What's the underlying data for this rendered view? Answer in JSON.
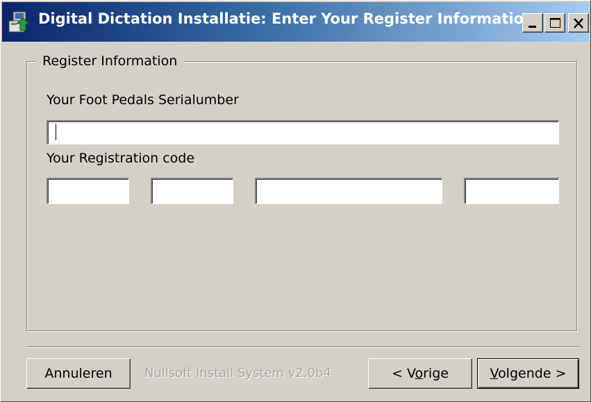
{
  "window": {
    "title": "Digital Dictation Installatie: Enter Your Register Information"
  },
  "group": {
    "legend": "Register Information",
    "serial_label": "Your Foot Pedals Serialumber",
    "serial_value": "",
    "registration_label": "Your Registration code",
    "code_fields": [
      "",
      "",
      "",
      ""
    ]
  },
  "footer": {
    "cancel_label": "Annuleren",
    "branding": "Nullsoft Install System v2.0b4",
    "back_prefix": "< V",
    "back_accel": "o",
    "back_suffix": "rige",
    "next_accel": "V",
    "next_suffix": "olgende >"
  },
  "icons": {
    "app": "installer-icon",
    "minimize": "minimize-icon",
    "maximize": "maximize-icon",
    "close": "close-icon"
  },
  "colors": {
    "titlebar_start": "#0a246a",
    "titlebar_end": "#a6caf0",
    "face": "#d4d0c8"
  }
}
